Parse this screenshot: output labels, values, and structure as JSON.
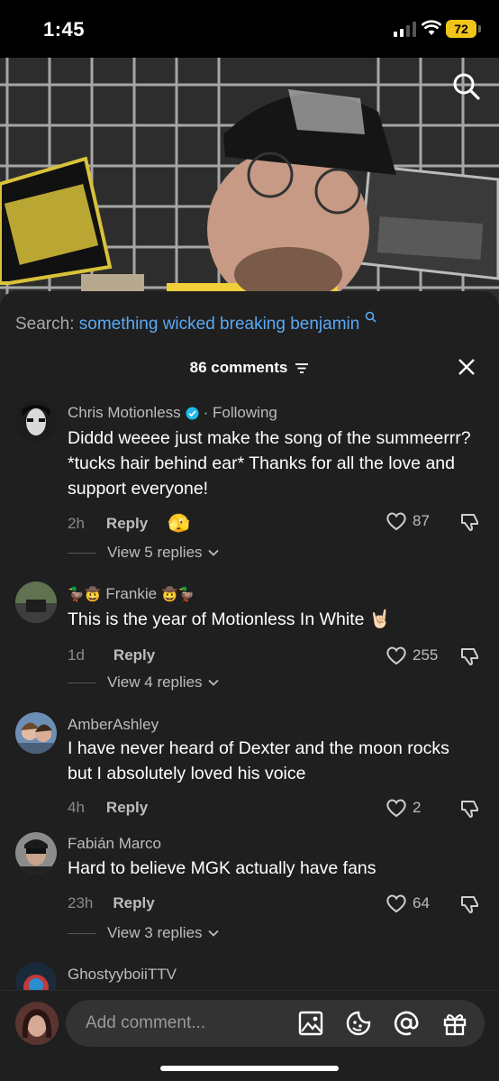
{
  "status": {
    "time": "1:45",
    "battery": "72"
  },
  "search": {
    "label": "Search: ",
    "query": "something wicked breaking benjamin"
  },
  "header": {
    "comments_count": "86 comments"
  },
  "comments": [
    {
      "user": "Chris Motionless",
      "verified": true,
      "following_label": "· Following",
      "text": "Diddd weeee just make the song of the summeerrr? *tucks hair behind ear* Thanks for all the love and support everyone!",
      "time": "2h",
      "reply_label": "Reply",
      "likes": "87",
      "view_replies": "View 5 replies"
    },
    {
      "user": "Frankie",
      "text": "This is the year of Motionless In White 🤘🏻",
      "time": "1d",
      "reply_label": "Reply",
      "likes": "255",
      "view_replies": "View 4 replies"
    },
    {
      "user": "AmberAshley",
      "text": "I have never heard of Dexter and the moon rocks but I absolutely loved his voice",
      "time": "4h",
      "reply_label": "Reply",
      "likes": "2"
    },
    {
      "user": "Fabián Marco",
      "text": "Hard to believe MGK actually have fans",
      "time": "23h",
      "reply_label": "Reply",
      "likes": "64",
      "view_replies": "View 3 replies"
    },
    {
      "user": "GhostyyboiiTTV"
    }
  ],
  "composer": {
    "placeholder": "Add comment..."
  },
  "colors": {
    "accent_link": "#5aa9f5",
    "sheet_bg": "#1f1f1f",
    "battery": "#f0c419"
  }
}
